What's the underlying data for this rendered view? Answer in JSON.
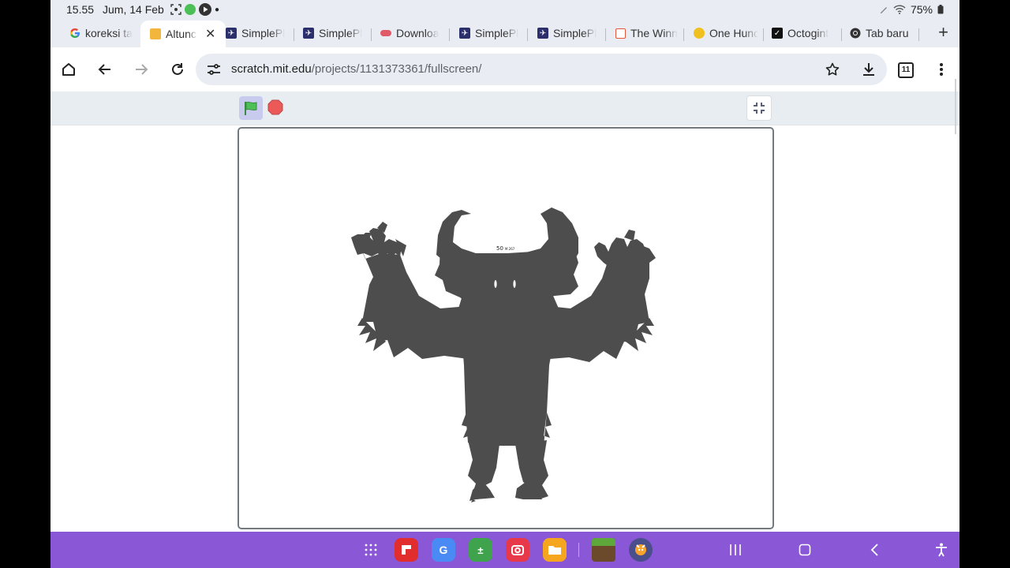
{
  "status_bar": {
    "time": "15.55",
    "date": "Jum, 14 Feb",
    "battery": "75%"
  },
  "tabs": [
    {
      "title": "koreksi ta",
      "favicon": "google-icon"
    },
    {
      "title": "Altunc",
      "favicon": "page-icon",
      "active": true
    },
    {
      "title": "SimplePl",
      "favicon": "simpleplanes-icon"
    },
    {
      "title": "SimplePl",
      "favicon": "simpleplanes-icon"
    },
    {
      "title": "Downloa",
      "favicon": "download-site-icon"
    },
    {
      "title": "SimplePl",
      "favicon": "simpleplanes-icon"
    },
    {
      "title": "SimplePl",
      "favicon": "simpleplanes-icon"
    },
    {
      "title": "The Winn",
      "favicon": "winn-icon"
    },
    {
      "title": "One Hunc",
      "favicon": "one-hundred-icon"
    },
    {
      "title": "Octogint",
      "favicon": "octogint-icon"
    },
    {
      "title": "Tab baru",
      "favicon": "chrome-icon"
    }
  ],
  "address_bar": {
    "domain": "scratch.mit.edu",
    "path": "/projects/1131373361/fullscreen/",
    "tab_count": "11"
  },
  "stage": {
    "sprite_label": "50",
    "sprite_sublabel": "M:267"
  },
  "colors": {
    "chrome_bg": "#e9edf3",
    "nav_bg": "#8a57d6",
    "monster": "#4d4d4d",
    "stop": "#ec5959",
    "flag": "#4cbf56"
  }
}
